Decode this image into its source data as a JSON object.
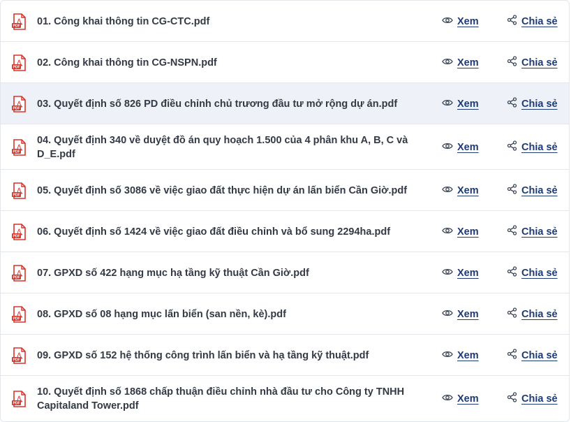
{
  "files": [
    {
      "name": "01. Công khai thông tin CG-CTC.pdf"
    },
    {
      "name": "02. Công khai thông tin CG-NSPN.pdf"
    },
    {
      "name": "03. Quyết định số 826 PD điều chỉnh chủ trương đầu tư mở rộng dự án.pdf"
    },
    {
      "name": "04. Quyết định 340 về duyệt đồ án quy hoạch 1.500 của 4 phân khu A, B, C và D_E.pdf"
    },
    {
      "name": "05. Quyết định số 3086 về việc giao đất thực hiện dự án lấn biển Cần Giờ.pdf"
    },
    {
      "name": "06. Quyết định số 1424 về việc giao đất điều chỉnh và bổ sung 2294ha.pdf"
    },
    {
      "name": "07. GPXD số 422 hạng mục hạ tầng kỹ thuật Cần Giờ.pdf"
    },
    {
      "name": "08. GPXD số 08 hạng mục lấn biển (san nền, kè).pdf"
    },
    {
      "name": "09. GPXD số 152 hệ thống công trình lấn biển và hạ tầng kỹ thuật.pdf"
    },
    {
      "name": "10. Quyết định số 1868 chấp thuận điều chỉnh nhà đầu tư cho Công ty TNHH Capitaland Tower.pdf"
    }
  ],
  "actions": {
    "view_label": "Xem",
    "share_label": "Chia sẻ"
  },
  "icons": {
    "file": "pdf-file-icon",
    "view": "eye-icon",
    "share": "share-icon"
  },
  "colors": {
    "pdf_red": "#d9342b",
    "link": "#1d3a73",
    "text": "#333a45",
    "row_highlight": "#eef2f8",
    "border": "#e3e6ea"
  },
  "highlighted_row_index": 2
}
